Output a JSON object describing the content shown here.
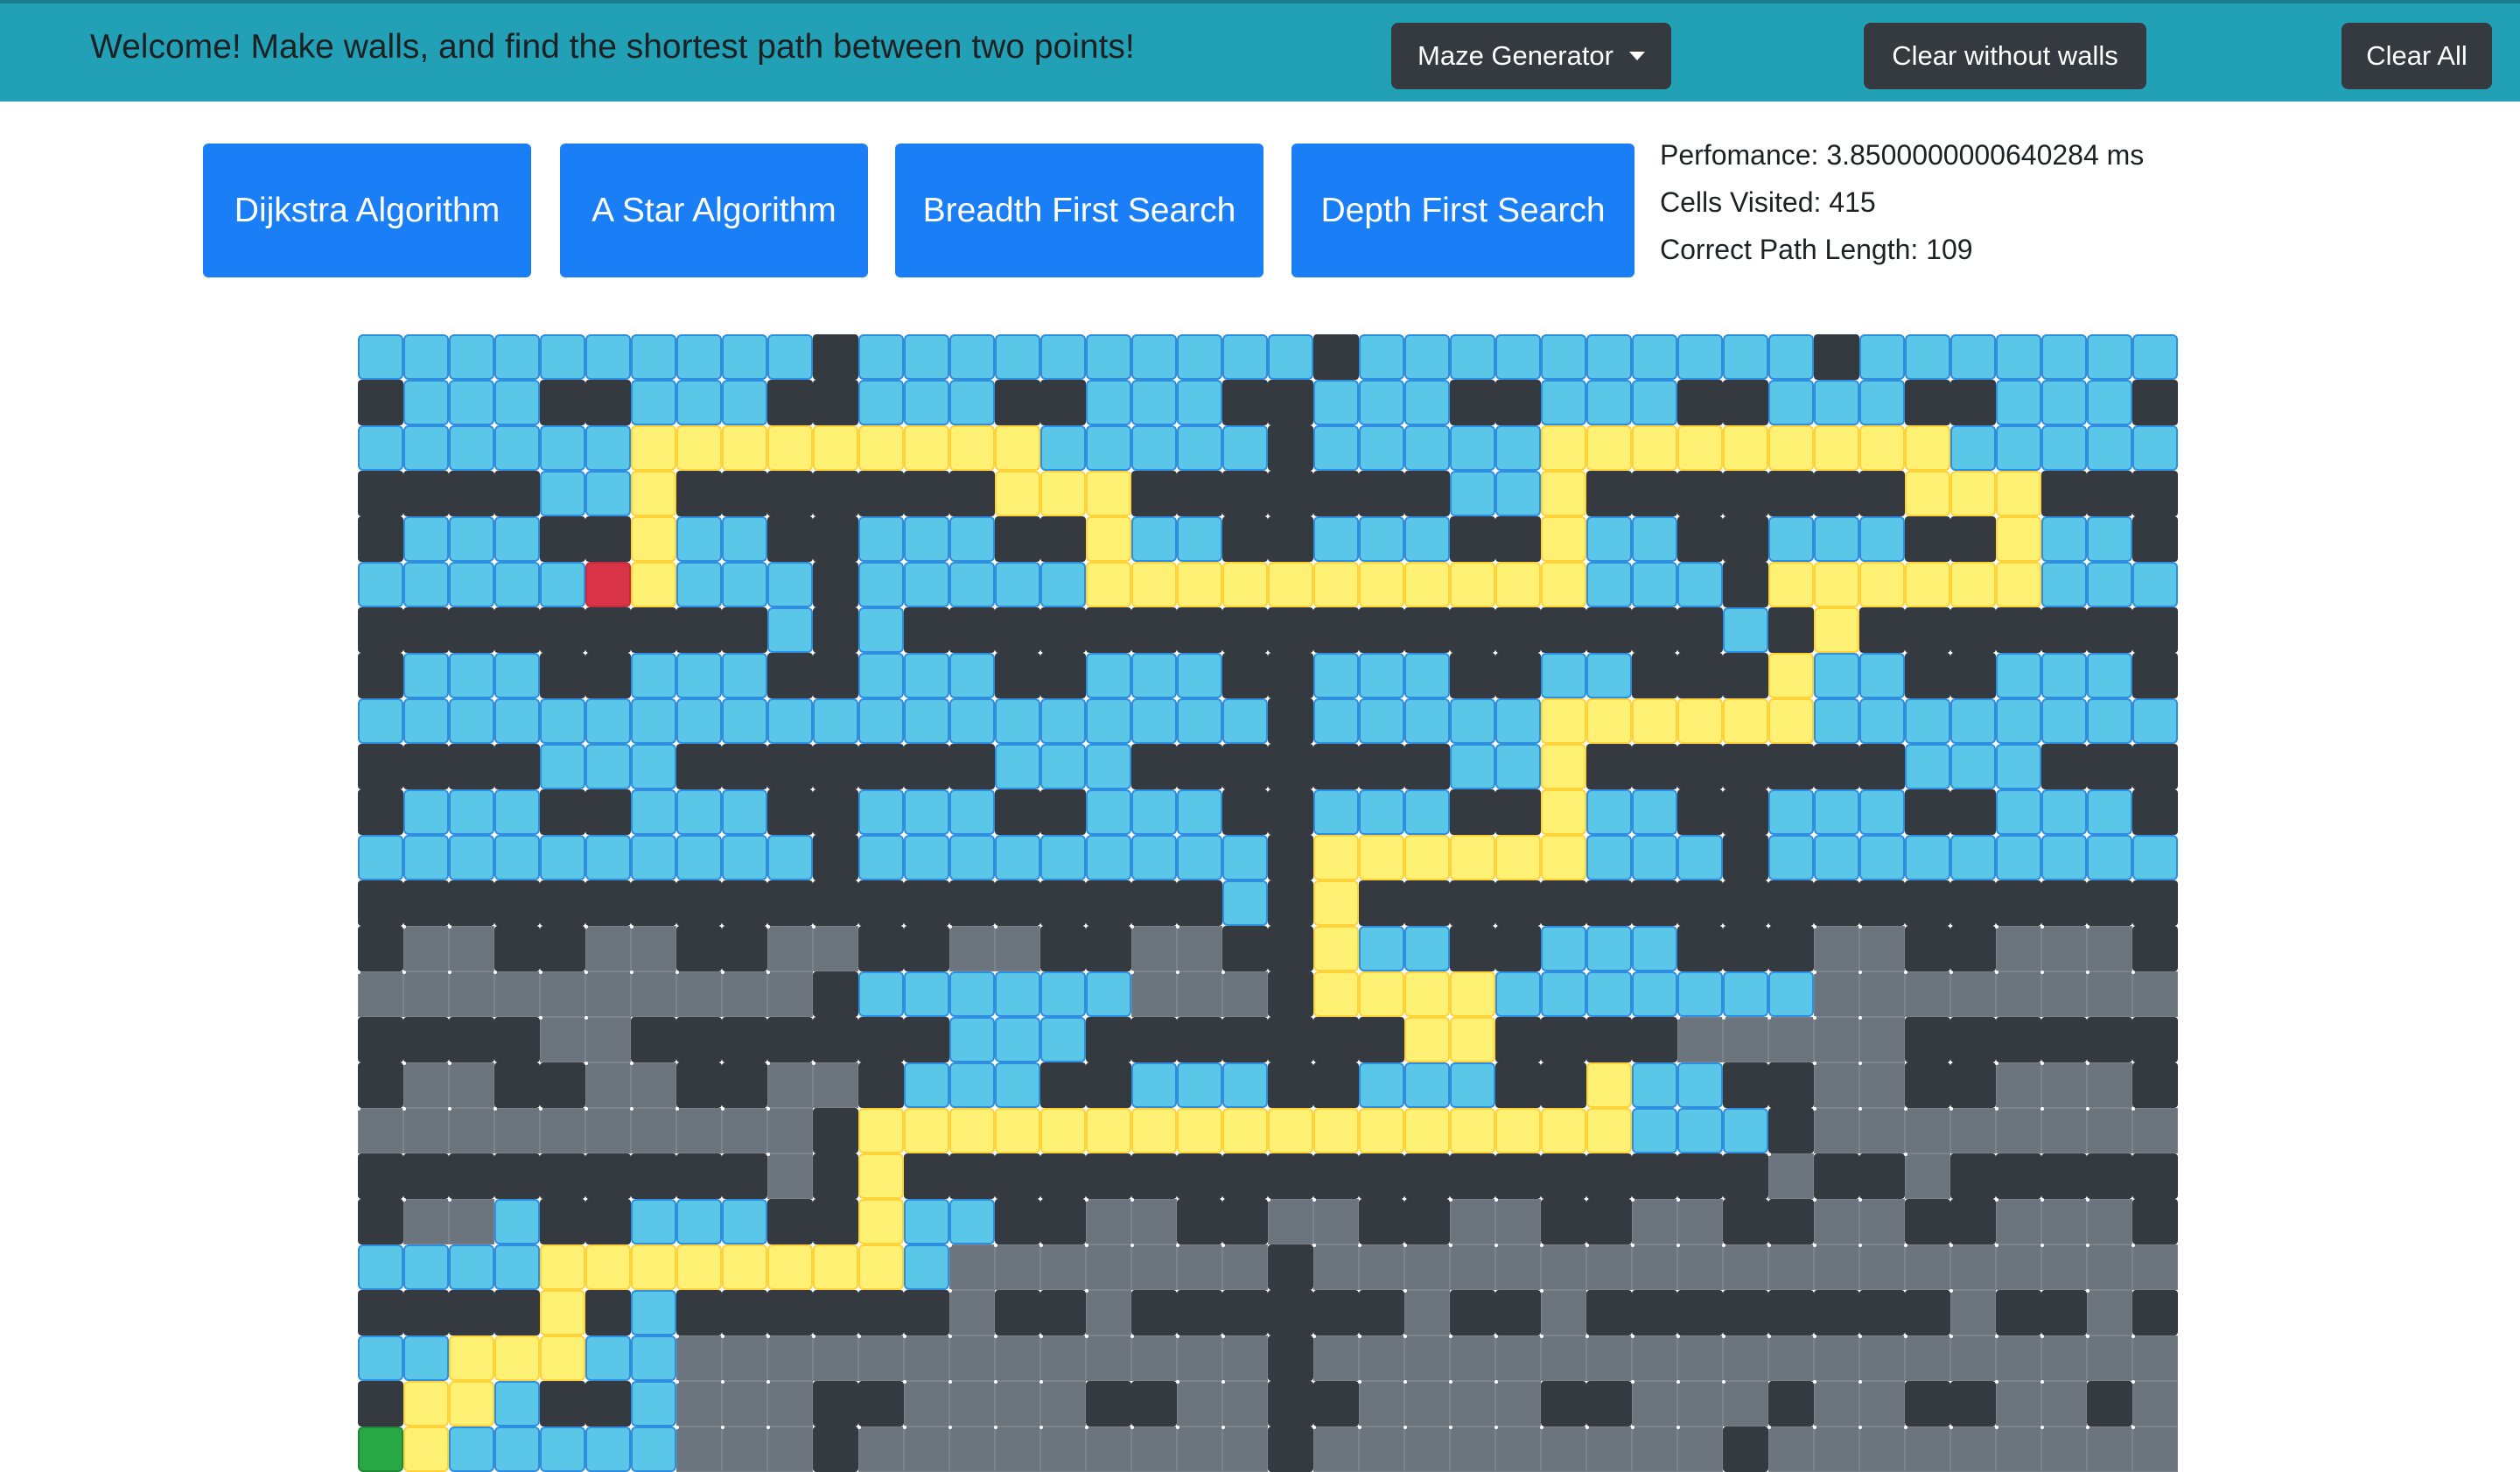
{
  "navbar": {
    "title": "Welcome! Make walls, and find the shortest path between two points!",
    "maze_generator_label": "Maze Generator",
    "clear_without_walls_label": "Clear without walls",
    "clear_all_label": "Clear All"
  },
  "algorithms": {
    "dijkstra_label": "Dijkstra Algorithm",
    "astar_label": "A Star Algorithm",
    "bfs_label": "Breadth First Search",
    "dfs_label": "Depth First Search"
  },
  "stats": {
    "performance": "Perfomance: 3.8500000000640284 ms",
    "cells_visited": "Cells Visited: 415",
    "path_length": "Correct Path Length: 109"
  },
  "colors": {
    "navbar": "#22a0b5",
    "button_dark": "#343a40",
    "button_primary": "#1a7ff7",
    "wall": "#343a40",
    "unvisited": "#6c757d",
    "visited": "#5bc7e8",
    "path": "#fff173",
    "start": "#d93347",
    "end": "#28a745"
  },
  "grid": {
    "legend": "W=wall, V=visited, P=path, S=start node, E=end node, .=unvisited",
    "rows": [
      "VVVVVVVVVVWVVVVVVVVVVWVVVVVVVVVVWVVVVVVVV",
      "WVVVWWVVVWWVVVWWVVVWWVVVWWVVVWWVVVWWVVVW",
      "VVVVVVPPPPPPPPPVVVVVWVVVVVPPPPPPPPPVVVVV",
      "WWWWVVPWWWWWWWPPPWWWWWWWVVPWWWWWWWPPPWWW",
      "WVVVWWPVVWWVVVWWPVVWWVVVWWPVVWWVVVWWPVVW",
      "VVVVVSPVVVWVVVVVPPPPPPPPPPPVVVWPPPPPPVVV",
      "WWWWWWWWWVWVWWWWWWWWWWWWWWWWWWVWPWWWWWWW",
      "WVVVWWVVVWWVVVWWVVVWWVVVWWVVWWWPVVWWVVVW",
      "VVVVVVVVVVVVVVVVVVVVWVVVVVPPPPPPVVVVVVVV",
      "WWWWVVVWWWWWWWVVVWWWWWWWVVPWWWWWWWVVVWWW",
      "WVVVWWVVVWWVVVWWVVVWWVVVWWPVVWWVVVWWVVVW",
      "VVVVVVVVVVWVVVVVVVVVWPPPPPPVVVWVVVVVVVVV",
      "WWWWWWWWWWWWWWWWWWWVWPWWWWWWWWWWWWWWWWWW",
      "W..WW..WW..WW..WW..WWPVVWWVVVWWW..WW...W",
      "..........WVVVVVV...WPPPPVVVVVVV........",
      "WWWW..WWWWWWWVVVWWWWWWWPPWWWW.....WWWWWW",
      "W..WW..WW..WVVVWWVVVWWVVVWWPVVWW..WW...W",
      "..........WPPPPPPPPPPPPPPPPPVVVW........",
      "WWWWWWWWW.WPWWWWWWWWWWWWWWWWWWW.WW.WWWWW",
      "W..VWWVVVWWPVVWW..WW..WW..WW..WW..WW...W",
      "VVVVPPPPPPPPV.......W.................",
      "WWWWPWVWWWWWW.WW.WWWWWW.WW.WWWWWWWW.WW.WWWWW",
      "VVPPPVV.............W..................",
      "WPPVWWV...WW....WW..WW....WW...W..WW..W",
      "EPVVVVV...W.........W.........W........"
    ]
  }
}
